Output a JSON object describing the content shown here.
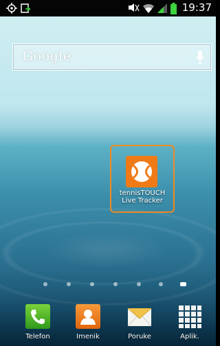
{
  "status_bar": {
    "time": "19:37",
    "icons": [
      "gps-icon",
      "sync-icon",
      "silent-icon",
      "wifi-icon",
      "signal-icon",
      "battery-icon"
    ]
  },
  "search_widget": {
    "logo": "Google",
    "mic_icon": "mic-icon"
  },
  "home_app": {
    "label": "tennisTOUCH\nLive Tracker",
    "icon": "tennis-ball-icon",
    "accent": "#f07a16"
  },
  "page_indicator": {
    "count": 7,
    "active_index": 6
  },
  "dock": {
    "items": [
      {
        "label": "Telefon",
        "icon": "phone-icon"
      },
      {
        "label": "Imenik",
        "icon": "contacts-icon"
      },
      {
        "label": "Poruke",
        "icon": "messages-icon"
      },
      {
        "label": "Aplik.",
        "icon": "apps-grid-icon"
      }
    ]
  }
}
